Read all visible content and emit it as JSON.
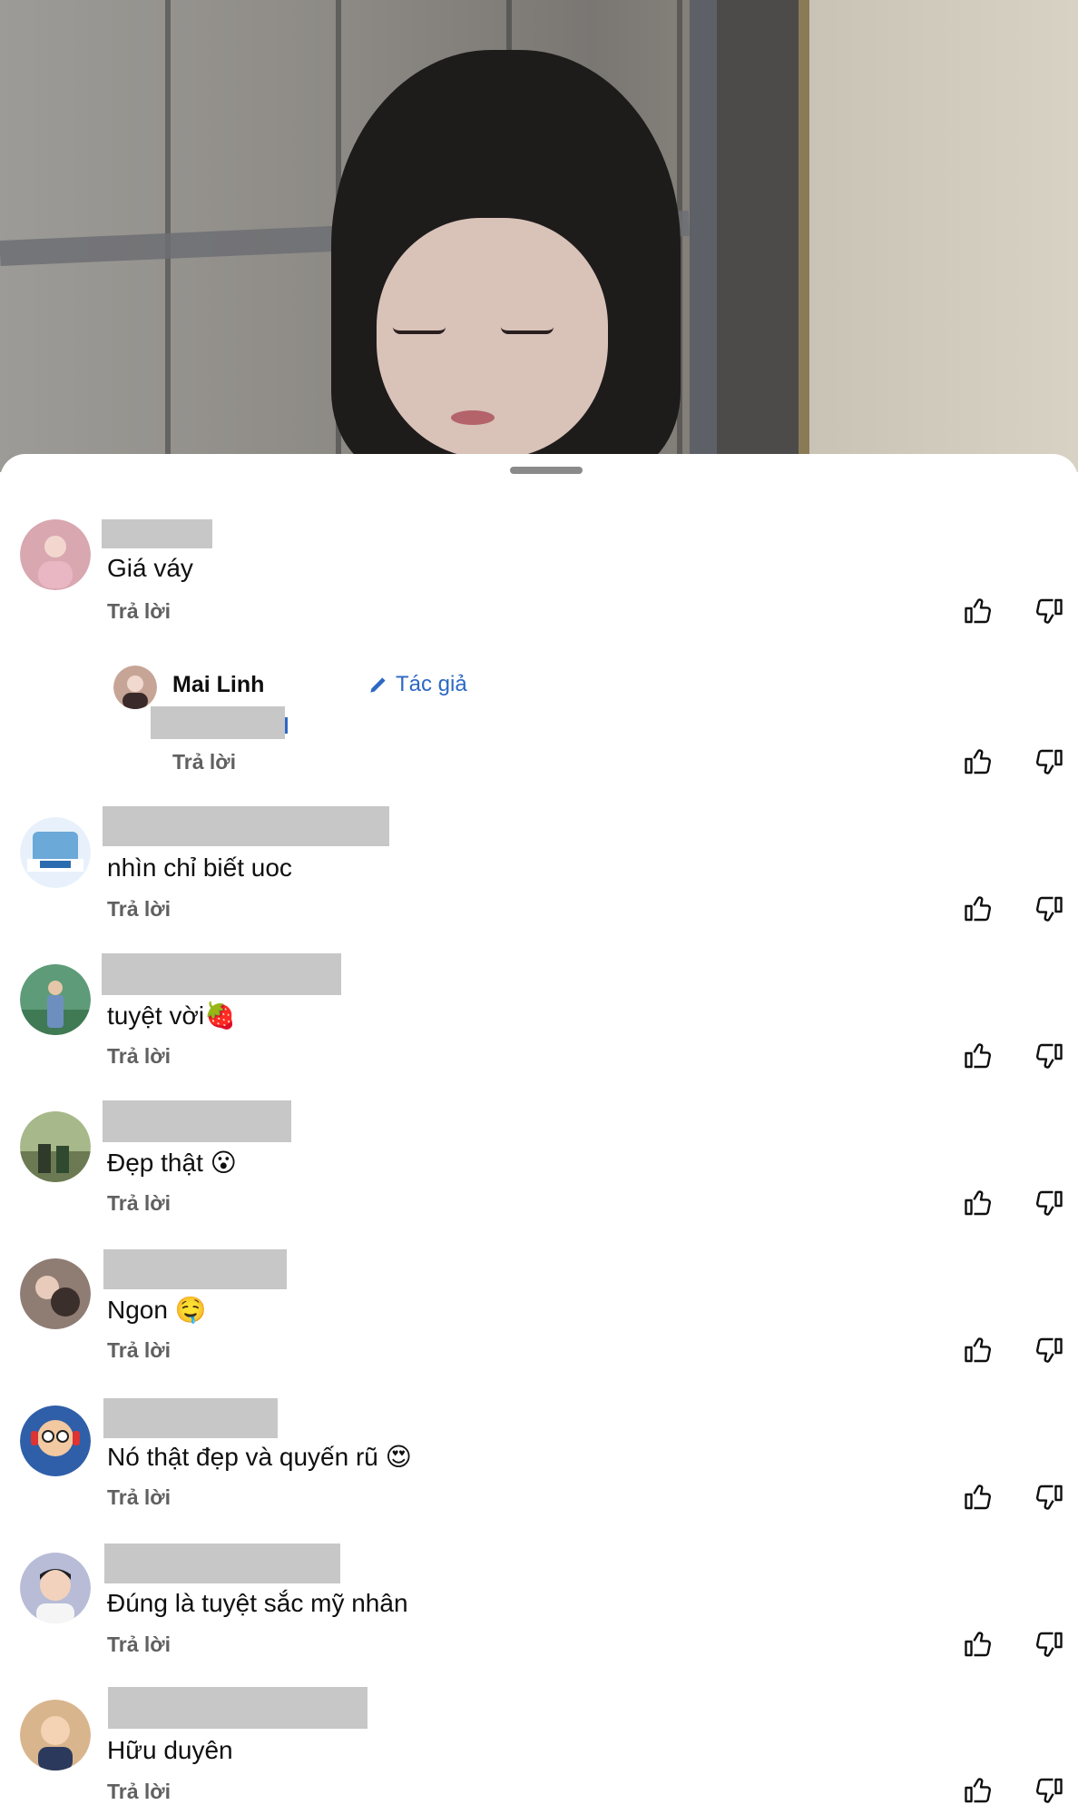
{
  "comments": [
    {
      "text": "Giá váy",
      "reply_label": "Trả lời",
      "avatar_color": "#d8a7b0"
    },
    {
      "author": "Mai Linh",
      "author_badge": "Tác giả",
      "reply_label": "Trả lời",
      "avatar_color": "#c7a596"
    },
    {
      "text": "nhìn chỉ biết uoc",
      "reply_label": "Trả lời",
      "avatar_color": "#6aa9d8"
    },
    {
      "text": "tuyệt vời",
      "emoji": "🍓",
      "reply_label": "Trả lời",
      "avatar_color": "#5e9b78"
    },
    {
      "text": "Đẹp thật",
      "emoji": "😮",
      "reply_label": "Trả lời",
      "avatar_color": "#6b7a52"
    },
    {
      "text": "Ngon",
      "emoji": "🤤",
      "reply_label": "Trả lời",
      "avatar_color": "#5b4a44"
    },
    {
      "text": "Nó thật đẹp và quyến rũ",
      "emoji": "😍",
      "reply_label": "Trả lời",
      "avatar_color": "#2f5fa8"
    },
    {
      "text": "Đúng là tuyệt sắc mỹ nhân",
      "reply_label": "Trả lời",
      "avatar_color": "#8a8fb5"
    },
    {
      "text": "Hữu duyên",
      "reply_label": "Trả lời",
      "avatar_color": "#caa27c"
    }
  ],
  "icons": {
    "like": "thumbs-up-icon",
    "dislike": "thumbs-down-icon",
    "edit": "pencil-icon"
  },
  "colors": {
    "accent": "#2d68c4",
    "redaction": "#c7c7c7",
    "secondary_text": "#606060"
  }
}
